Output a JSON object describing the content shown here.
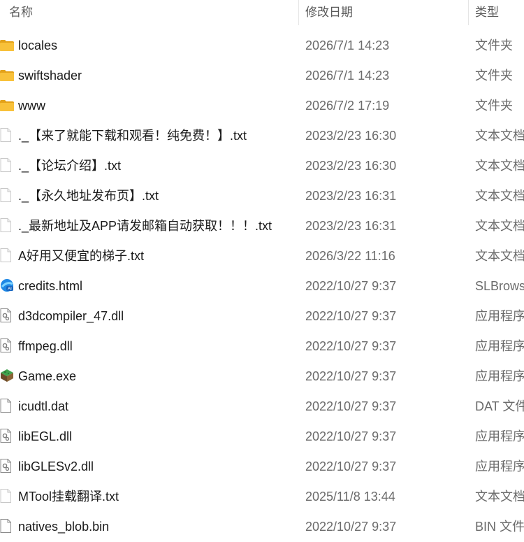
{
  "columns": {
    "name": "名称",
    "date": "修改日期",
    "type": "类型"
  },
  "files": [
    {
      "name": "locales",
      "date": "2026/7/1 14:23",
      "type": "文件夹",
      "icon": "folder-icon"
    },
    {
      "name": "swiftshader",
      "date": "2026/7/1 14:23",
      "type": "文件夹",
      "icon": "folder-icon"
    },
    {
      "name": "www",
      "date": "2026/7/2 17:19",
      "type": "文件夹",
      "icon": "folder-icon"
    },
    {
      "name": "._【来了就能下载和观看！纯免费！】.txt",
      "date": "2023/2/23 16:30",
      "type": "文本文档",
      "icon": "text-file-icon"
    },
    {
      "name": "._【论坛介绍】.txt",
      "date": "2023/2/23 16:30",
      "type": "文本文档",
      "icon": "text-file-icon"
    },
    {
      "name": "._【永久地址发布页】.txt",
      "date": "2023/2/23 16:31",
      "type": "文本文档",
      "icon": "text-file-icon"
    },
    {
      "name": "._最新地址及APP请发邮箱自动获取！！！.txt",
      "date": "2023/2/23 16:31",
      "type": "文本文档",
      "icon": "text-file-icon"
    },
    {
      "name": "A好用又便宜的梯子.txt",
      "date": "2026/3/22 11:16",
      "type": "文本文档",
      "icon": "text-file-icon"
    },
    {
      "name": "credits.html",
      "date": "2022/10/27 9:37",
      "type": "SLBrowser",
      "icon": "browser-html-icon"
    },
    {
      "name": "d3dcompiler_47.dll",
      "date": "2022/10/27 9:37",
      "type": "应用程序扩展",
      "icon": "dll-file-icon"
    },
    {
      "name": "ffmpeg.dll",
      "date": "2022/10/27 9:37",
      "type": "应用程序扩展",
      "icon": "dll-file-icon"
    },
    {
      "name": "Game.exe",
      "date": "2022/10/27 9:37",
      "type": "应用程序",
      "icon": "game-exe-icon"
    },
    {
      "name": "icudtl.dat",
      "date": "2022/10/27 9:37",
      "type": "DAT 文件",
      "icon": "blank-file-icon"
    },
    {
      "name": "libEGL.dll",
      "date": "2022/10/27 9:37",
      "type": "应用程序扩展",
      "icon": "dll-file-icon"
    },
    {
      "name": "libGLESv2.dll",
      "date": "2022/10/27 9:37",
      "type": "应用程序扩展",
      "icon": "dll-file-icon"
    },
    {
      "name": "MTool挂载翻译.txt",
      "date": "2025/11/8 13:44",
      "type": "文本文档",
      "icon": "text-file-icon"
    },
    {
      "name": "natives_blob.bin",
      "date": "2022/10/27 9:37",
      "type": "BIN 文件",
      "icon": "blank-file-icon"
    }
  ],
  "colors": {
    "folder": "#f8c13a",
    "folder_dark": "#e3a21a",
    "dim_text": "#6b6b6b"
  }
}
